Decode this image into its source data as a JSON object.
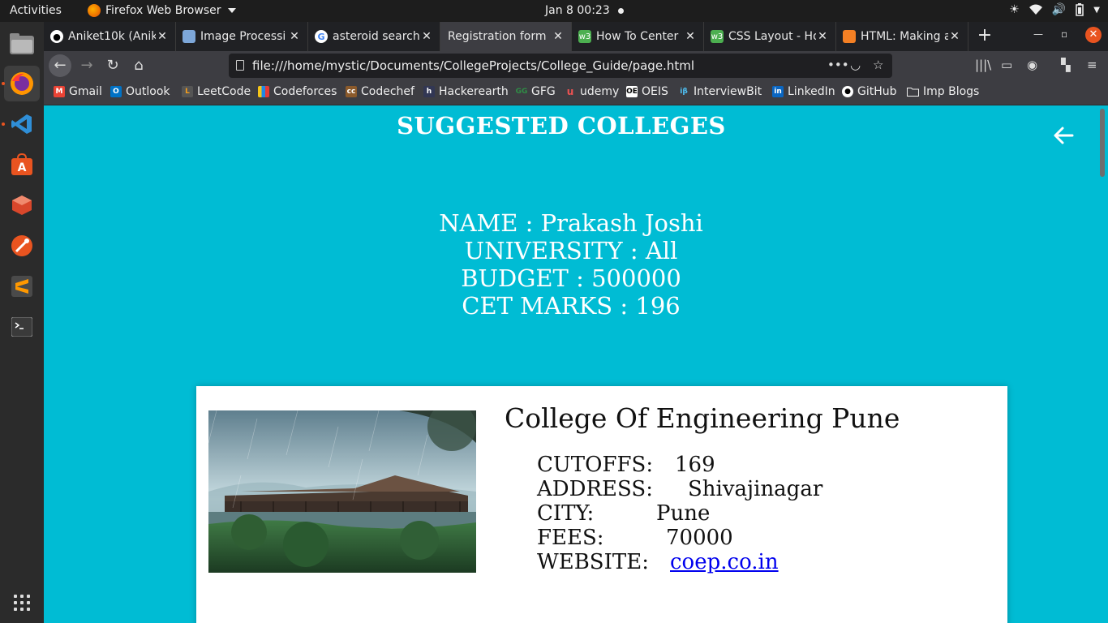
{
  "topbar": {
    "activities": "Activities",
    "app_name": "Firefox Web Browser",
    "clock": "Jan 8  00:23"
  },
  "dock": {
    "items": [
      "files-icon",
      "firefox-icon",
      "vscode-icon",
      "software-center-icon",
      "virtualbox-icon",
      "web-tool-icon",
      "sublime-text-icon",
      "terminal-icon"
    ]
  },
  "browser": {
    "tabs": [
      {
        "label": "Aniket10k (Anik",
        "icon": "github-icon"
      },
      {
        "label": "Image Processi",
        "icon": "doc-icon"
      },
      {
        "label": "asteroid search",
        "icon": "google-icon"
      },
      {
        "label": "Registration form",
        "icon": "none",
        "selected": true
      },
      {
        "label": "How To Center",
        "icon": "w3-icon"
      },
      {
        "label": "CSS Layout - Ho",
        "icon": "w3-icon"
      },
      {
        "label": "HTML: Making a",
        "icon": "stackoverflow-icon"
      }
    ],
    "url": "file:///home/mystic/Documents/CollegeProjects/College_Guide/page.html",
    "bookmarks": [
      "Gmail",
      "Outlook",
      "LeetCode",
      "Codeforces",
      "Codechef",
      "Hackerearth",
      "GFG",
      "udemy",
      "OEIS",
      "InterviewBit",
      "LinkedIn",
      "GitHub",
      "Imp Blogs"
    ]
  },
  "page": {
    "title": "SUGGESTED COLLEGES",
    "student": {
      "name_line": "NAME : Prakash Joshi",
      "university_line": "UNIVERSITY : All",
      "budget_line": "BUDGET : 500000",
      "cet_line": "CET MARKS : 196"
    },
    "college": {
      "name": "College Of Engineering Pune",
      "cutoffs_label": "CUTOFFS:",
      "cutoffs_value": "169",
      "address_label": "ADDRESS:",
      "address_value": "Shivajinagar",
      "city_label": "CITY:",
      "city_value": "Pune",
      "fees_label": "FEES:",
      "fees_value": "70000",
      "website_label": "WEBSITE:",
      "website_value": "coep.co.in"
    }
  },
  "colors": {
    "page_bg": "#00bcd4",
    "link": "#0000ee",
    "ubuntu_orange": "#e95420"
  }
}
